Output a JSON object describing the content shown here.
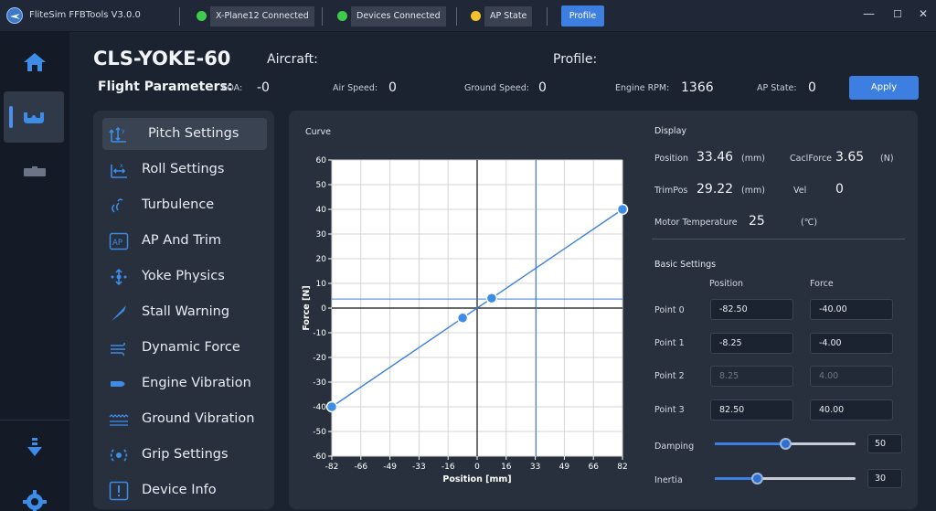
{
  "app": {
    "title": "FliteSim FFBTools V3.0.0",
    "status": [
      {
        "label": "X-Plane12 Connected",
        "color": "#3fcc4a"
      },
      {
        "label": "Devices Connected",
        "color": "#3fcc4a"
      },
      {
        "label": "AP State",
        "color": "#f2c12e"
      }
    ],
    "profile_button": "Profile",
    "window_controls": {
      "minimize": "—",
      "maximize": "☐",
      "close": "✕"
    }
  },
  "rail": [
    "home-icon",
    "yoke-icon",
    "throttle-icon",
    "download-icon",
    "settings-gear-icon"
  ],
  "header": {
    "device": "CLS-YOKE-60",
    "aircraft_label": "Aircraft:",
    "profile_label": "Profile:",
    "flight_params_label": "Flight Parameters:",
    "params": [
      {
        "label": "AOA:",
        "value": "-0"
      },
      {
        "label": "Air Speed:",
        "value": "0"
      },
      {
        "label": "Ground Speed:",
        "value": "0"
      },
      {
        "label": "Engine RPM:",
        "value": "1366"
      },
      {
        "label": "AP State:",
        "value": "0"
      }
    ],
    "apply_button": "Apply"
  },
  "menu": {
    "selected": 0,
    "items": [
      {
        "label": "Pitch Settings",
        "icon": "pitch-axis-icon"
      },
      {
        "label": "Roll Settings",
        "icon": "roll-axis-icon"
      },
      {
        "label": "Turbulence",
        "icon": "turbulence-icon"
      },
      {
        "label": "AP And Trim",
        "icon": "ap-icon"
      },
      {
        "label": "Yoke Physics",
        "icon": "yoke-physics-icon"
      },
      {
        "label": "Stall Warning",
        "icon": "stall-warning-icon"
      },
      {
        "label": "Dynamic Force",
        "icon": "dynamic-force-icon"
      },
      {
        "label": "Engine Vibration",
        "icon": "engine-vibration-icon"
      },
      {
        "label": "Ground Vibration",
        "icon": "ground-vibration-icon"
      },
      {
        "label": "Grip Settings",
        "icon": "grip-settings-icon"
      },
      {
        "label": "Device Info",
        "icon": "device-info-icon"
      }
    ]
  },
  "curve": {
    "title": "Curve"
  },
  "chart_data": {
    "type": "line",
    "xlabel": "Position [mm]",
    "ylabel": "Force [N]",
    "xlim": [
      -82.5,
      82.5
    ],
    "ylim": [
      -60,
      60
    ],
    "xticks": [
      "-82",
      "-66",
      "-49",
      "-33",
      "-16",
      "0",
      "16",
      "33",
      "49",
      "66",
      "82"
    ],
    "yticks": [
      "60",
      "50",
      "40",
      "30",
      "20",
      "10",
      "0",
      "-10",
      "-20",
      "-30",
      "-40",
      "-50",
      "-60"
    ],
    "grid": true,
    "series": [
      {
        "x": [
          -82.5,
          -8.25,
          8.25,
          82.5
        ],
        "y": [
          -40,
          -4,
          4,
          40
        ],
        "markers": [
          true,
          true,
          true,
          true
        ]
      }
    ],
    "cursor": {
      "position": 33.46,
      "force": 3.65
    }
  },
  "display": {
    "title": "Display",
    "position_label": "Position",
    "position_value": "33.46",
    "position_unit": "(mm)",
    "calc_force_label": "CaclForce",
    "calc_force_value": "3.65",
    "calc_force_unit": "(N)",
    "trimpos_label": "TrimPos",
    "trimpos_value": "29.22",
    "trimpos_unit": "(mm)",
    "vel_label": "Vel",
    "vel_value": "0",
    "motor_temp_label": "Motor Temperature",
    "motor_temp_value": "25",
    "motor_temp_unit": "(℃)"
  },
  "basic": {
    "title": "Basic Settings",
    "col_position": "Position",
    "col_force": "Force",
    "points": [
      {
        "label": "Point 0",
        "position": "-82.50",
        "force": "-40.00",
        "disabled": false
      },
      {
        "label": "Point 1",
        "position": "-8.25",
        "force": "-4.00",
        "disabled": false
      },
      {
        "label": "Point 2",
        "position": "8.25",
        "force": "4.00",
        "disabled": true
      },
      {
        "label": "Point 3",
        "position": "82.50",
        "force": "40.00",
        "disabled": false
      }
    ],
    "damping": {
      "label": "Damping",
      "value": "50",
      "fraction": 0.5
    },
    "inertia": {
      "label": "Inertia",
      "value": "30",
      "fraction": 0.3
    }
  }
}
